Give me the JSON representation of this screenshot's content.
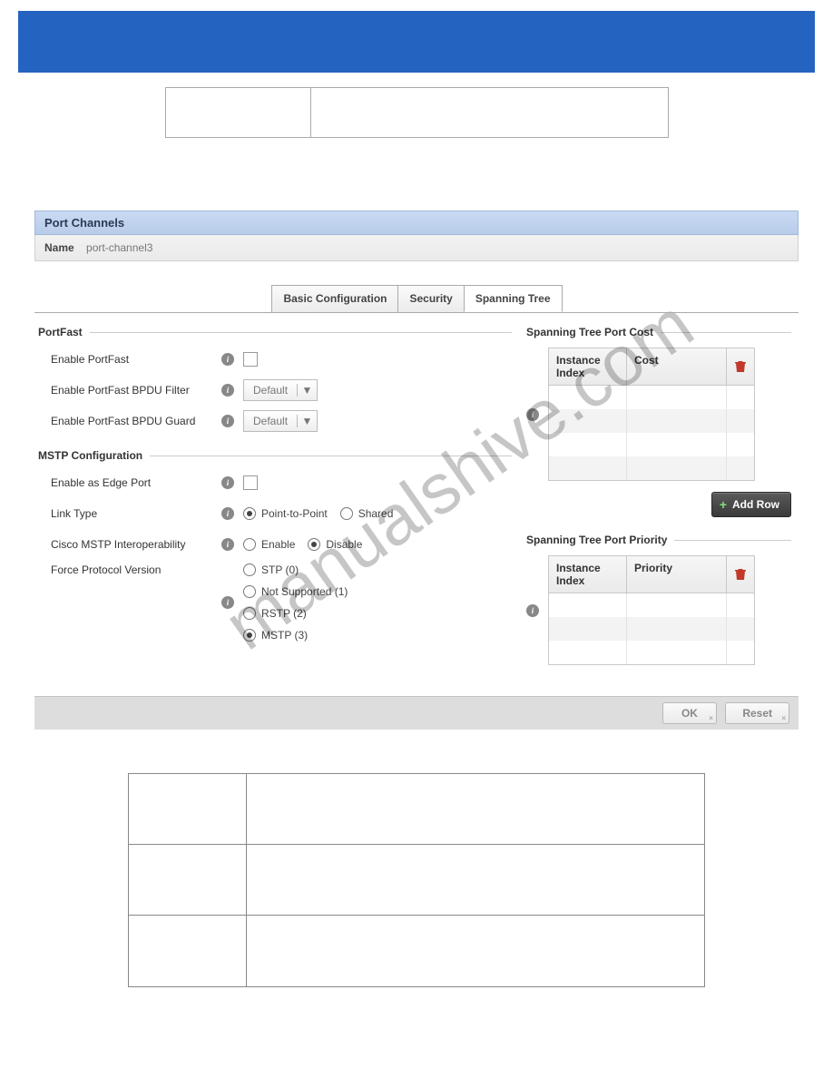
{
  "panel": {
    "title": "Port Channels",
    "name_label": "Name",
    "name_value": "port-channel3"
  },
  "tabs": {
    "basic": "Basic Configuration",
    "security": "Security",
    "spanning": "Spanning Tree"
  },
  "portfast": {
    "header": "PortFast",
    "enable": "Enable PortFast",
    "bpdu_filter": "Enable PortFast BPDU Filter",
    "bpdu_guard": "Enable PortFast BPDU Guard",
    "default": "Default"
  },
  "mstp": {
    "header": "MSTP Configuration",
    "edge_port": "Enable as Edge Port",
    "link_type": "Link Type",
    "link_p2p": "Point-to-Point",
    "link_shared": "Shared",
    "interop": "Cisco MSTP Interoperability",
    "interop_enable": "Enable",
    "interop_disable": "Disable",
    "force_version": "Force Protocol Version",
    "fv_stp": "STP (0)",
    "fv_ns": "Not Supported (1)",
    "fv_rstp": "RSTP (2)",
    "fv_mstp": "MSTP (3)"
  },
  "cost_table": {
    "header": "Spanning Tree Port Cost",
    "col1": "Instance Index",
    "col2": "Cost"
  },
  "priority_table": {
    "header": "Spanning Tree Port Priority",
    "col1": "Instance Index",
    "col2": "Priority"
  },
  "buttons": {
    "add_row": "Add Row",
    "ok": "OK",
    "reset": "Reset"
  }
}
